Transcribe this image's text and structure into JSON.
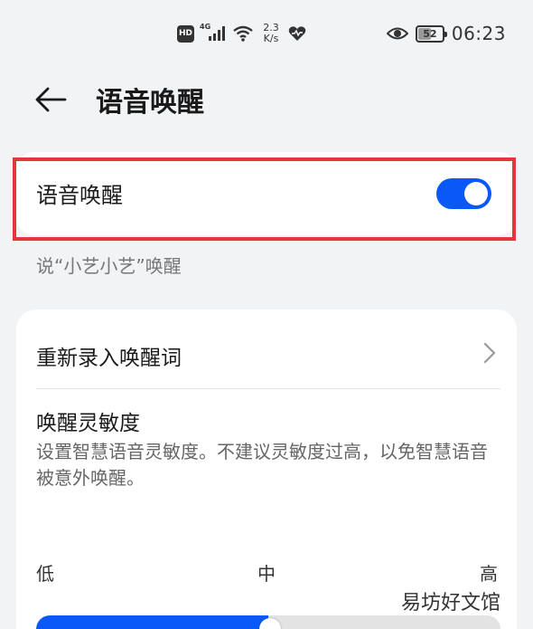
{
  "status_bar": {
    "hd_badge": "HD",
    "net_type": "4G",
    "net_speed_value": "2.3",
    "net_speed_unit": "K/s",
    "battery_level": "52",
    "time": "06:23"
  },
  "header": {
    "title": "语音唤醒"
  },
  "voice_wake": {
    "label": "语音唤醒",
    "enabled": true,
    "hint": "说“小艺小艺”唤醒"
  },
  "settings": {
    "rerecord_label": "重新录入唤醒词",
    "sensitivity_title": "唤醒灵敏度",
    "sensitivity_desc": "设置智慧语音灵敏度。不建议灵敏度过高，以免智慧语音被意外唤醒。",
    "levels": {
      "low": "低",
      "mid": "中",
      "high": "高"
    },
    "sensitivity_value": 0.5
  },
  "watermark": "易坊好文馆",
  "colors": {
    "accent": "#0a59f7",
    "highlight_border": "#e8343c",
    "background": "#f1f3f5"
  }
}
